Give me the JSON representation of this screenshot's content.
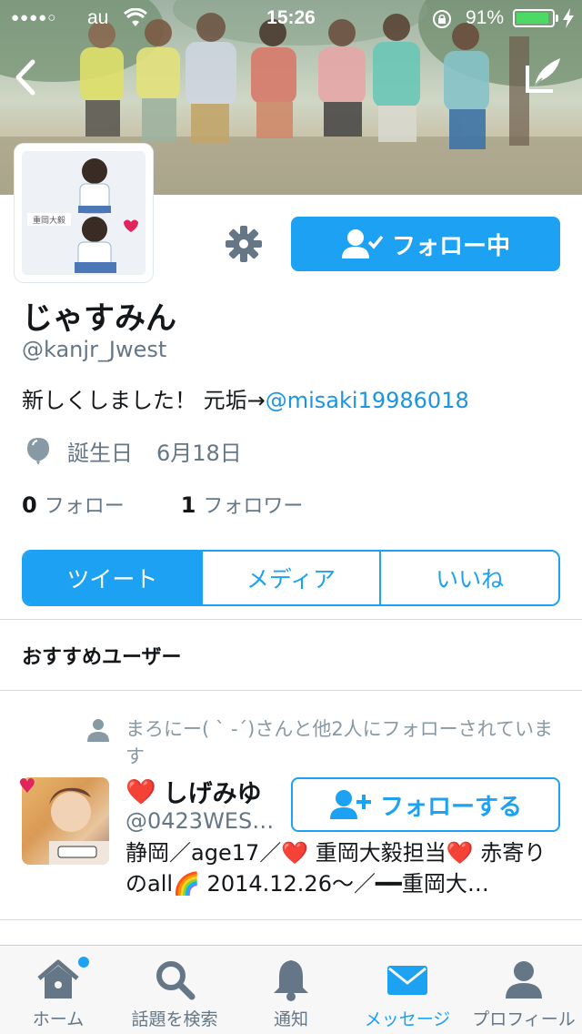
{
  "status_bar": {
    "signal": "●●●●○",
    "carrier": "au",
    "time": "15:26",
    "battery_percent": "91%",
    "battery_level": 0.91,
    "icons": [
      "wifi-icon",
      "rotation-lock-icon",
      "battery-icon",
      "charging-bolt-icon"
    ]
  },
  "header": {
    "back_icon": "chevron-left-icon",
    "compose_icon": "compose-tweet-icon"
  },
  "profile": {
    "name": "じゃすみん",
    "handle": "@kanjr_Jwest",
    "bio_text": "新しくしました！ 元垢→",
    "bio_link": "@misaki19986018",
    "birthday_label": "誕生日",
    "birthday_value": "6月18日",
    "following_count": "0",
    "following_label": "フォロー",
    "followers_count": "1",
    "followers_label": "フォロワー",
    "avatar_caption": "重岡大毅"
  },
  "actions": {
    "settings_icon": "gear-icon",
    "follow_button_label": "フォロー中"
  },
  "tabs": [
    {
      "label": "ツイート",
      "active": true
    },
    {
      "label": "メディア",
      "active": false
    },
    {
      "label": "いいね",
      "active": false
    }
  ],
  "recommended": {
    "section_title": "おすすめユーザー",
    "social_context": "まろにー( ˋ -ˊ)さんと他2人にフォローされています",
    "user": {
      "name": "しげみゆ",
      "heart": "❤️",
      "handle": "@0423WEST…",
      "follow_label": "フォローする",
      "bio": "静岡／age17／❤️ 重岡大毅担当❤️ 赤寄りのall🌈 2014.12.26〜／━━重岡大…"
    }
  },
  "tabbar": [
    {
      "label": "ホーム",
      "icon": "home-icon",
      "active": false,
      "badge": true
    },
    {
      "label": "話題を検索",
      "icon": "search-icon",
      "active": false,
      "badge": false
    },
    {
      "label": "通知",
      "icon": "bell-icon",
      "active": false,
      "badge": false
    },
    {
      "label": "メッセージ",
      "icon": "envelope-icon",
      "active": true,
      "badge": false
    },
    {
      "label": "プロフィール",
      "icon": "person-icon",
      "active": false,
      "badge": false
    }
  ],
  "colors": {
    "accent": "#1da1f2",
    "link": "#1b95e0",
    "secondary_text": "#657786",
    "heart": "#e0245e",
    "battery_fill": "#4cd964"
  }
}
